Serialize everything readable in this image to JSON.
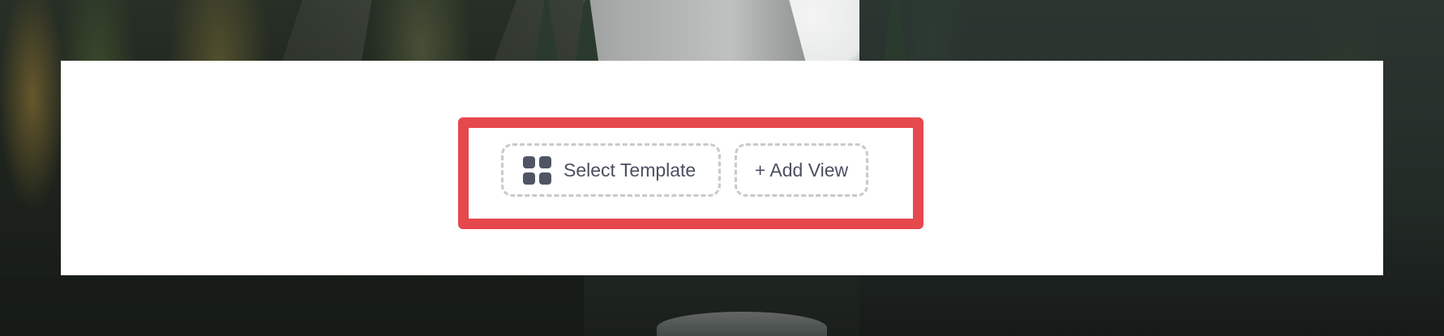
{
  "toolbar": {
    "select_template_label": "Select Template",
    "select_template_icon": "grid-icon",
    "add_view_label": "+ Add View"
  },
  "colors": {
    "highlight_border": "#e5484d",
    "button_text": "#4b5060",
    "button_border": "#c9c9c9",
    "panel_background": "#ffffff"
  }
}
